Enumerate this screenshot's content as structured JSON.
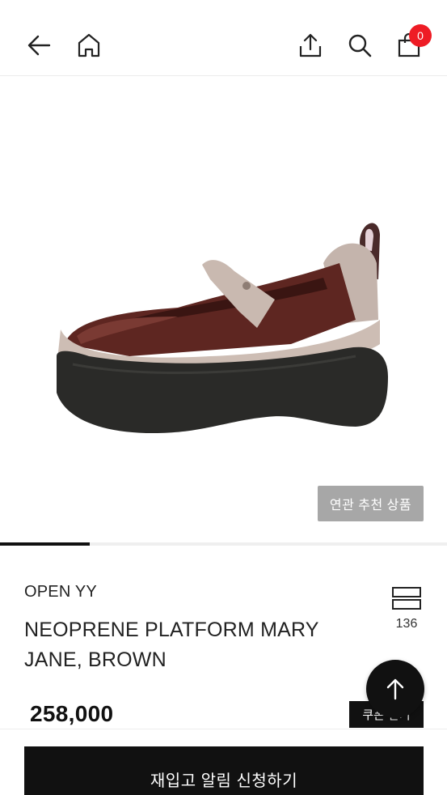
{
  "header": {
    "back_icon": "arrow-left-icon",
    "home_icon": "home-icon",
    "share_icon": "share-icon",
    "search_icon": "search-icon",
    "cart_icon": "shopping-bag-icon",
    "cart_count": "0"
  },
  "gallery": {
    "image_subject": "brown neoprene platform mary jane shoe",
    "progress": 0.2,
    "related_label": "연관 추천 상품"
  },
  "product": {
    "brand": "OPEN YY",
    "name": "NEOPRENE PLATFORM MARY JANE, BROWN",
    "likes_icon": "stack-icon",
    "likes": "136",
    "price": "258,000",
    "coupon_label": "쿠폰 받기"
  },
  "scroll_top_icon": "arrow-up-icon",
  "action": {
    "restock_label": "재입고 알림 신청하기"
  },
  "colors": {
    "accent_badge": "#ee1c25",
    "primary_button": "#111111",
    "secondary_button": "#a7a7a7"
  }
}
